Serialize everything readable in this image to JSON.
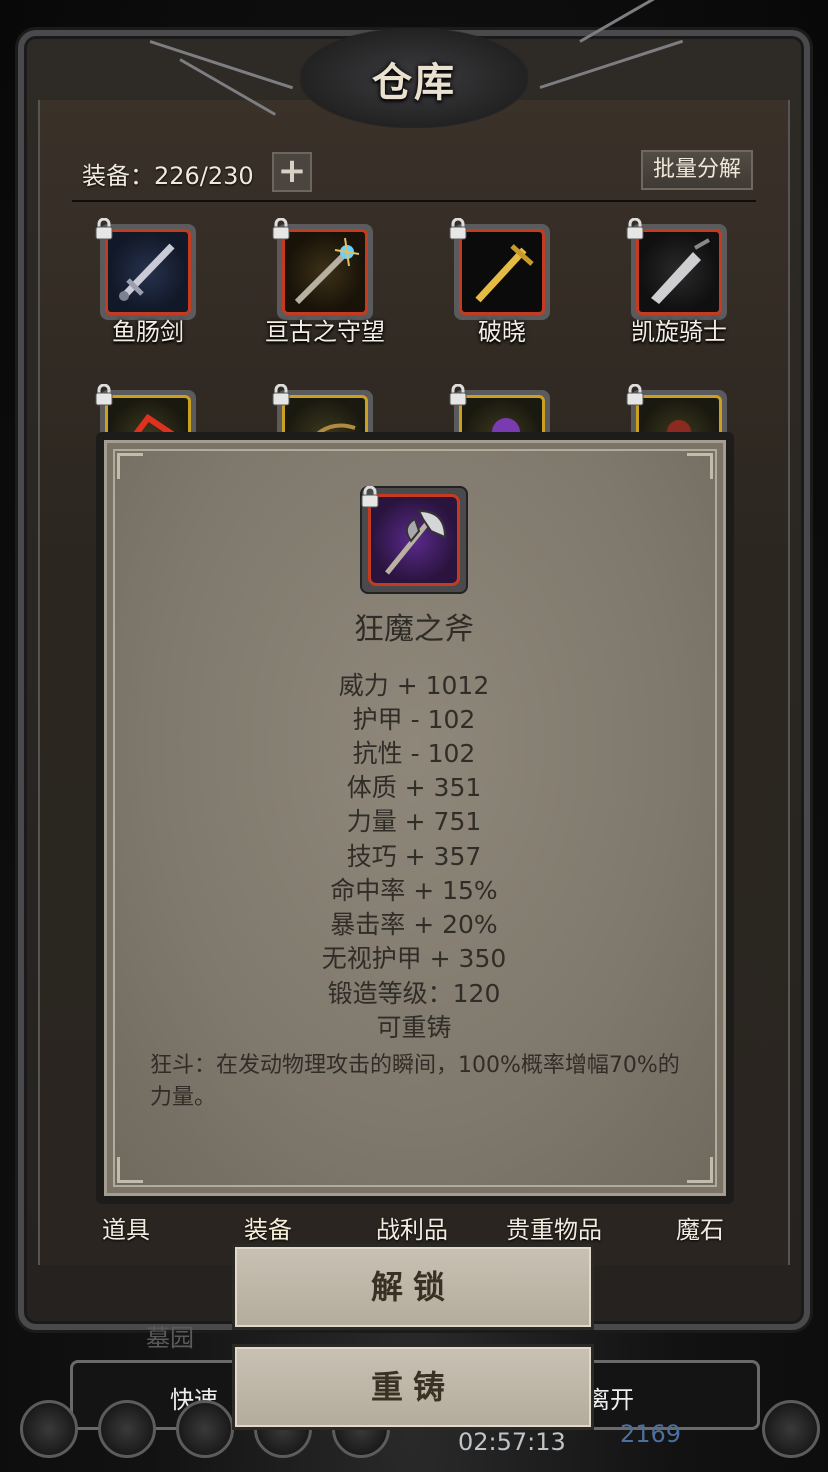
{
  "window": {
    "title": "仓库"
  },
  "inventory": {
    "equip_label": "装备：226/230",
    "add_label": "+",
    "batch_label": "批量分解",
    "items": [
      {
        "name": "鱼肠剑",
        "frame": "red",
        "icon": "sword-icon"
      },
      {
        "name": "亘古之守望",
        "frame": "red",
        "icon": "staff-icon"
      },
      {
        "name": "破晓",
        "frame": "red",
        "icon": "golden-sword-icon"
      },
      {
        "name": "凯旋骑士",
        "frame": "red",
        "icon": "greatsword-icon"
      },
      {
        "name": "",
        "frame": "gold",
        "icon": "claw-icon"
      },
      {
        "name": "",
        "frame": "gold",
        "icon": "bow-icon"
      },
      {
        "name": "",
        "frame": "gold",
        "icon": "axe-icon"
      },
      {
        "name": "",
        "frame": "gold",
        "icon": "mace-icon"
      }
    ]
  },
  "tabs": [
    {
      "label": "道具"
    },
    {
      "label": "装备"
    },
    {
      "label": "战利品"
    },
    {
      "label": "贵重物品"
    },
    {
      "label": "魔石"
    }
  ],
  "hud": {
    "left_label": "快速",
    "right_label": "离开",
    "partial_label": "墓园",
    "timer": "02:57:13",
    "gems": "2169"
  },
  "detail": {
    "name": "狂魔之斧",
    "icon": "battle-axe-icon",
    "stats": [
      "威力 + 1012",
      "护甲 - 102",
      "抗性 - 102",
      "体质 + 351",
      "力量 + 751",
      "技巧 + 357",
      "命中率 + 15%",
      "暴击率 + 20%",
      "无视护甲 + 350",
      "锻造等级：120",
      "可重铸"
    ],
    "skill": "狂斗：在发动物理攻击的瞬间，100%概率增幅70%的力量。"
  },
  "actions": {
    "unlock_label": "解锁",
    "reforge_label": "重铸"
  },
  "colors": {
    "rare_frame": "#c43b1f",
    "gold_frame": "#c9a020",
    "paper": "#8e877a",
    "text_dark": "#302d28"
  }
}
